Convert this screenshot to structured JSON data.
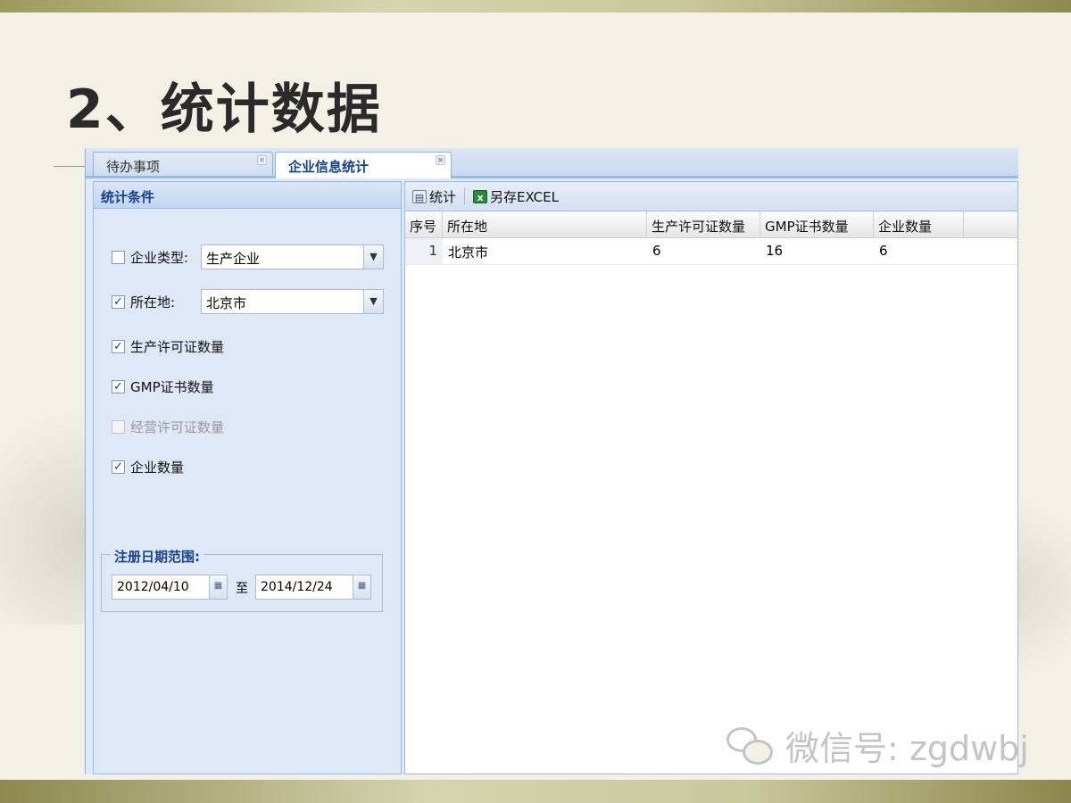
{
  "slide": {
    "title": "2、统计数据"
  },
  "tabs": [
    {
      "label": "待办事项",
      "close": "×",
      "active": false
    },
    {
      "label": "企业信息统计",
      "close": "×",
      "active": true
    }
  ],
  "left_panel": {
    "title": "统计条件",
    "enterprise_type": {
      "label": "企业类型:",
      "checked": false,
      "value": "生产企业"
    },
    "location": {
      "label": "所在地:",
      "checked": true,
      "value": "北京市"
    },
    "options": [
      {
        "label": "生产许可证数量",
        "checked": true,
        "disabled": false
      },
      {
        "label": "GMP证书数量",
        "checked": true,
        "disabled": false
      },
      {
        "label": "经营许可证数量",
        "checked": false,
        "disabled": true
      },
      {
        "label": "企业数量",
        "checked": true,
        "disabled": false
      }
    ],
    "check_mark": "✓",
    "date_range": {
      "legend": "注册日期范围:",
      "from": "2012/04/10",
      "to_label": "至",
      "to": "2014/12/24"
    }
  },
  "toolbar": {
    "stats_label": "统计",
    "export_label": "另存EXCEL",
    "stats_icon": "table-icon",
    "export_icon": "excel-icon"
  },
  "grid": {
    "columns": [
      "序号",
      "所在地",
      "生产许可证数量",
      "GMP证书数量",
      "企业数量"
    ],
    "rows": [
      {
        "index": "1",
        "location": "北京市",
        "production_licenses": "6",
        "gmp_certificates": "16",
        "enterprise_count": "6"
      }
    ]
  },
  "watermark": {
    "text": "微信号: zgdwbj"
  },
  "colors": {
    "accent": "#15428b",
    "panel_border": "#99bbe8",
    "panel_bg": "#dfe8f6"
  }
}
